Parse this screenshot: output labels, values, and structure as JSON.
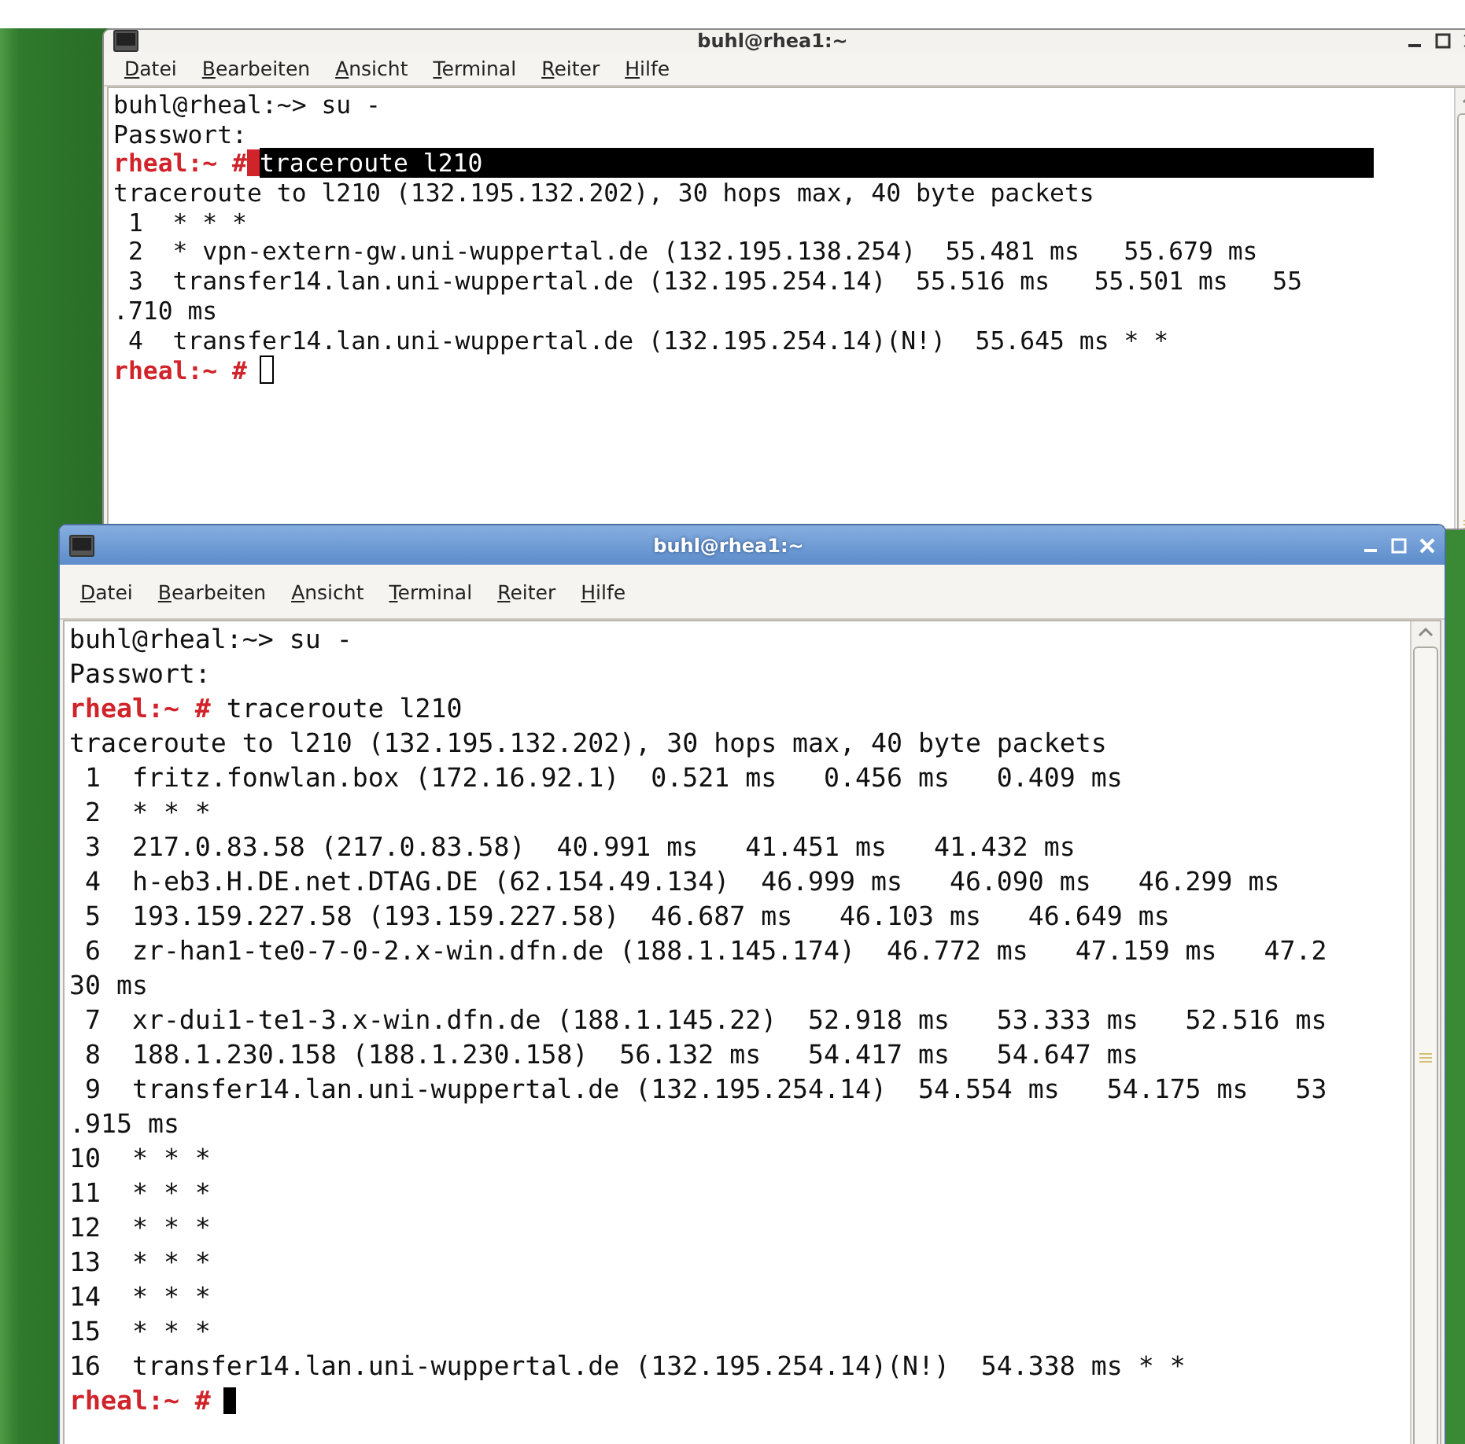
{
  "windows": [
    {
      "title": "buhl@rhea1:~",
      "focused": false,
      "menu": [
        "Datei",
        "Bearbeiten",
        "Ansicht",
        "Terminal",
        "Reiter",
        "Hilfe"
      ],
      "lines": [
        {
          "kind": "output",
          "text": "buhl@rheal:~> su -"
        },
        {
          "kind": "output",
          "text": "Passwort:"
        },
        {
          "kind": "prompt",
          "prompt": "rheal:~ #",
          "command": "traceroute l210",
          "selected": true,
          "cursor": false
        },
        {
          "kind": "output",
          "text": "traceroute to l210 (132.195.132.202), 30 hops max, 40 byte packets"
        },
        {
          "kind": "output",
          "text": " 1  * * *"
        },
        {
          "kind": "output",
          "text": " 2  * vpn-extern-gw.uni-wuppertal.de (132.195.138.254)  55.481 ms   55.679 ms"
        },
        {
          "kind": "output",
          "text": " 3  transfer14.lan.uni-wuppertal.de (132.195.254.14)  55.516 ms   55.501 ms   55"
        },
        {
          "kind": "output",
          "text": ".710 ms"
        },
        {
          "kind": "output",
          "text": " 4  transfer14.lan.uni-wuppertal.de (132.195.254.14)(N!)  55.645 ms * *"
        },
        {
          "kind": "prompt",
          "prompt": "rheal:~ #",
          "selected": false,
          "cursor": true
        }
      ]
    },
    {
      "title": "buhl@rhea1:~",
      "focused": true,
      "menu": [
        "Datei",
        "Bearbeiten",
        "Ansicht",
        "Terminal",
        "Reiter",
        "Hilfe"
      ],
      "lines": [
        {
          "kind": "output",
          "text": "buhl@rheal:~> su -"
        },
        {
          "kind": "output",
          "text": "Passwort:"
        },
        {
          "kind": "prompt",
          "prompt": "rheal:~ #",
          "command": " traceroute l210",
          "selected": false,
          "cursor": false
        },
        {
          "kind": "output",
          "text": "traceroute to l210 (132.195.132.202), 30 hops max, 40 byte packets"
        },
        {
          "kind": "output",
          "text": " 1  fritz.fonwlan.box (172.16.92.1)  0.521 ms   0.456 ms   0.409 ms"
        },
        {
          "kind": "output",
          "text": " 2  * * *"
        },
        {
          "kind": "output",
          "text": " 3  217.0.83.58 (217.0.83.58)  40.991 ms   41.451 ms   41.432 ms"
        },
        {
          "kind": "output",
          "text": " 4  h-eb3.H.DE.net.DTAG.DE (62.154.49.134)  46.999 ms   46.090 ms   46.299 ms"
        },
        {
          "kind": "output",
          "text": " 5  193.159.227.58 (193.159.227.58)  46.687 ms   46.103 ms   46.649 ms"
        },
        {
          "kind": "output",
          "text": " 6  zr-han1-te0-7-0-2.x-win.dfn.de (188.1.145.174)  46.772 ms   47.159 ms   47.2"
        },
        {
          "kind": "output",
          "text": "30 ms"
        },
        {
          "kind": "output",
          "text": " 7  xr-dui1-te1-3.x-win.dfn.de (188.1.145.22)  52.918 ms   53.333 ms   52.516 ms"
        },
        {
          "kind": "output",
          "text": " 8  188.1.230.158 (188.1.230.158)  56.132 ms   54.417 ms   54.647 ms"
        },
        {
          "kind": "output",
          "text": " 9  transfer14.lan.uni-wuppertal.de (132.195.254.14)  54.554 ms   54.175 ms   53"
        },
        {
          "kind": "output",
          "text": ".915 ms"
        },
        {
          "kind": "output",
          "text": "10  * * *"
        },
        {
          "kind": "output",
          "text": "11  * * *"
        },
        {
          "kind": "output",
          "text": "12  * * *"
        },
        {
          "kind": "output",
          "text": "13  * * *"
        },
        {
          "kind": "output",
          "text": "14  * * *"
        },
        {
          "kind": "output",
          "text": "15  * * *"
        },
        {
          "kind": "output",
          "text": "16  transfer14.lan.uni-wuppertal.de (132.195.254.14)(N!)  54.338 ms * *"
        },
        {
          "kind": "prompt",
          "prompt": "rheal:~ #",
          "selected": false,
          "cursor": true
        }
      ]
    }
  ]
}
